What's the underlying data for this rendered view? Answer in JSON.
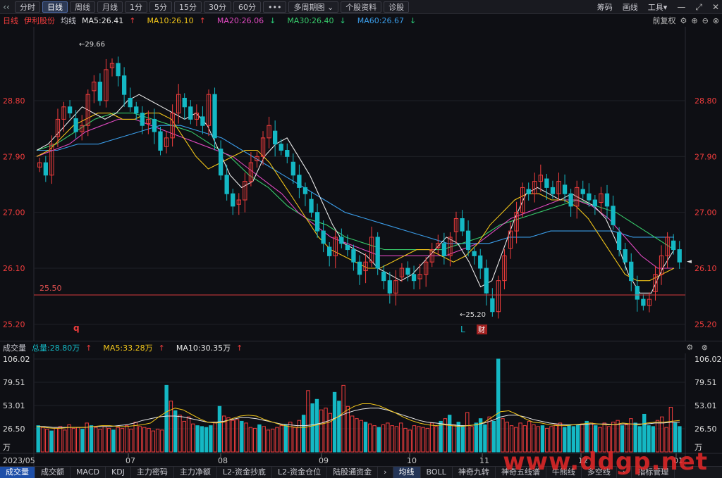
{
  "toolbar": {
    "back_icon": "‹‹",
    "periods": [
      "分时",
      "日线",
      "周线",
      "月线",
      "1分",
      "5分",
      "15分",
      "30分",
      "60分",
      "•••",
      "多周期图 ⌄",
      "个股资料",
      "诊股"
    ],
    "active_period": "日线",
    "right": {
      "chips": "筹码",
      "draw": "画线",
      "tools": "工具▾"
    }
  },
  "info": {
    "period": "日线",
    "stock": "伊利股份",
    "avg_label": "均线",
    "ma5": "MA5:26.41",
    "ma10": "MA10:26.10",
    "ma20": "MA20:26.06",
    "ma30": "MA30:26.40",
    "ma60": "MA60:26.67",
    "adjust": "前复权"
  },
  "volume_header": {
    "title": "成交量",
    "total": "总量:28.80万",
    "ma5": "MA5:33.28万",
    "ma10": "MA10:30.35万"
  },
  "bottom_tabs": [
    "成交量",
    "成交额",
    "MACD",
    "KDJ",
    "主力密码",
    "主力净额",
    "L2-资金抄底",
    "L2-资金仓位",
    "陆股通资金",
    "›",
    "均线",
    "BOLL",
    "神奇九转",
    "神奇五线谱",
    "牛熊线",
    "多空线",
    "›",
    "指标管理"
  ],
  "watermark": "www.ddgp.net",
  "colors": {
    "up": "#f23d3d",
    "down": "#14b8c4",
    "ma5": "#e8e8e8",
    "ma10": "#f0c419",
    "ma20": "#e049c0",
    "ma30": "#37c96a",
    "ma60": "#3a9ce8",
    "ref_line": "#d63b3b"
  },
  "chart_data": [
    {
      "type": "candlestick",
      "price_axis": {
        "ticks": [
          "28.80",
          "27.90",
          "27.00",
          "26.10",
          "25.20"
        ],
        "ylim": [
          25.0,
          29.9
        ]
      },
      "x_ticks": [
        "2023/05",
        "07",
        "08",
        "09",
        "10",
        "11",
        "12",
        "01"
      ],
      "annotations": {
        "high": "29.66",
        "low": "25.20",
        "ref_value": "25.50",
        "marker_q": "q",
        "marker_L": "L",
        "marker_cai": "财",
        "current_price": "26.10"
      },
      "closes": [
        27.8,
        27.6,
        28.1,
        28.5,
        28.7,
        28.6,
        28.3,
        28.4,
        28.9,
        29.1,
        28.8,
        29.3,
        29.4,
        29.2,
        28.9,
        28.7,
        28.6,
        28.4,
        28.5,
        28.3,
        28.0,
        28.2,
        28.6,
        28.9,
        28.7,
        28.5,
        28.6,
        28.4,
        28.9,
        28.2,
        27.6,
        27.3,
        27.1,
        27.2,
        27.5,
        27.8,
        27.9,
        28.2,
        28.4,
        28.1,
        28.0,
        27.9,
        27.6,
        27.4,
        27.3,
        27.0,
        26.7,
        26.5,
        26.3,
        26.6,
        26.5,
        26.4,
        26.2,
        26.0,
        26.2,
        26.6,
        26.1,
        25.9,
        25.7,
        25.9,
        26.1,
        26.0,
        25.9,
        26.0,
        26.2,
        26.4,
        26.5,
        26.3,
        26.6,
        26.9,
        26.7,
        26.4,
        26.3,
        26.1,
        25.7,
        25.4,
        25.9,
        26.3,
        26.7,
        27.0,
        27.4,
        27.3,
        27.5,
        27.6,
        27.4,
        27.3,
        27.5,
        27.3,
        27.1,
        27.4,
        27.3,
        27.2,
        27.1,
        27.3,
        27.1,
        26.8,
        26.4,
        26.2,
        25.9,
        25.6,
        25.5,
        25.6,
        26.0,
        26.3,
        26.6,
        26.4,
        26.2
      ],
      "ma5": [
        28.0,
        28.1,
        28.3,
        28.5,
        28.7,
        28.6,
        28.5,
        28.6,
        28.8,
        28.9,
        28.8,
        28.7,
        28.6,
        28.5,
        28.6,
        28.4,
        28.0,
        27.6,
        27.4,
        27.5,
        27.9,
        28.1,
        28.2,
        27.9,
        27.6,
        27.2,
        26.8,
        26.5,
        26.4,
        26.3,
        26.1,
        26.0,
        25.9,
        26.0,
        26.2,
        26.4,
        26.6,
        26.5,
        26.2,
        25.8,
        25.9,
        26.4,
        26.9,
        27.3,
        27.4,
        27.3,
        27.2,
        27.3,
        27.2,
        27.1,
        26.9,
        26.5,
        26.0,
        25.7,
        25.7,
        26.1,
        26.4
      ],
      "ma10": [
        27.9,
        28.0,
        28.2,
        28.4,
        28.5,
        28.6,
        28.6,
        28.5,
        28.5,
        28.6,
        28.6,
        28.5,
        28.2,
        27.9,
        27.7,
        27.8,
        27.9,
        28.0,
        28.0,
        27.8,
        27.5,
        27.2,
        26.9,
        26.6,
        26.4,
        26.3,
        26.2,
        26.1,
        26.1,
        26.2,
        26.3,
        26.4,
        26.4,
        26.3,
        26.2,
        26.3,
        26.5,
        26.8,
        27.0,
        27.2,
        27.3,
        27.3,
        27.2,
        27.2,
        27.1,
        26.9,
        26.6,
        26.3,
        26.0,
        25.9,
        25.9,
        26.0,
        26.1
      ],
      "ma20": [
        27.9,
        28.0,
        28.1,
        28.3,
        28.4,
        28.5,
        28.5,
        28.4,
        28.3,
        28.2,
        28.1,
        28.0,
        27.9,
        27.7,
        27.5,
        27.3,
        27.0,
        26.8,
        26.6,
        26.5,
        26.4,
        26.3,
        26.3,
        26.3,
        26.3,
        26.3,
        26.4,
        26.5,
        26.7,
        26.9,
        27.0,
        27.1,
        27.2,
        27.2,
        27.1,
        26.9,
        26.6,
        26.3,
        26.1,
        26.1
      ],
      "ma30": [
        28.0,
        28.1,
        28.3,
        28.5,
        28.6,
        28.6,
        28.5,
        28.4,
        28.3,
        28.1,
        27.9,
        27.6,
        27.4,
        27.1,
        26.9,
        26.8,
        26.6,
        26.5,
        26.4,
        26.4,
        26.4,
        26.4,
        26.5,
        26.6,
        26.8,
        26.9,
        27.0,
        27.1,
        27.2,
        27.1,
        27.0,
        26.8,
        26.6,
        26.4
      ],
      "ma60": [
        28.0,
        28.0,
        28.1,
        28.1,
        28.2,
        28.3,
        28.4,
        28.4,
        28.3,
        28.2,
        28.0,
        27.8,
        27.6,
        27.4,
        27.2,
        27.0,
        26.9,
        26.8,
        26.7,
        26.6,
        26.5,
        26.5,
        26.5,
        26.6,
        26.6,
        26.7,
        26.7,
        26.7,
        26.7,
        26.6,
        26.6,
        26.6
      ]
    },
    {
      "type": "bar",
      "volume_axis": {
        "ticks": [
          "106.02",
          "79.51",
          "53.01",
          "26.50",
          "万"
        ],
        "ylim": [
          0,
          106.02
        ]
      },
      "volumes": [
        30,
        28,
        26,
        24,
        27,
        29,
        25,
        31,
        27,
        28,
        26,
        33,
        30,
        28,
        26,
        29,
        27,
        25,
        28,
        27,
        30,
        26,
        34,
        29,
        28,
        27,
        24,
        26,
        25,
        76,
        58,
        47,
        42,
        35,
        40,
        32,
        30,
        29,
        28,
        30,
        34,
        52,
        41,
        39,
        36,
        37,
        35,
        33,
        28,
        27,
        31,
        29,
        25,
        26,
        28,
        30,
        31,
        34,
        28,
        36,
        42,
        70,
        55,
        60,
        48,
        50,
        44,
        68,
        58,
        76,
        52,
        41,
        38,
        36,
        34,
        32,
        30,
        28,
        31,
        33,
        30,
        29,
        33,
        27,
        25,
        30,
        29,
        28,
        27,
        33,
        29,
        35,
        38,
        42,
        31,
        34,
        30,
        45,
        29,
        33,
        38,
        31,
        40,
        35,
        106,
        38,
        34,
        30,
        28,
        33,
        30,
        35,
        31,
        29,
        30,
        27,
        29,
        31,
        33,
        28,
        30,
        29,
        31,
        32,
        35,
        33,
        30,
        28,
        33,
        29,
        34,
        36,
        30,
        31,
        38,
        33,
        29,
        43,
        30,
        29,
        36,
        40,
        28,
        51,
        33,
        29
      ],
      "ma5_vol": [
        29,
        28,
        27,
        27,
        28,
        28,
        28,
        29,
        30,
        30,
        29,
        29,
        30,
        31,
        33,
        40,
        46,
        50,
        48,
        43,
        38,
        34,
        33,
        34,
        38,
        41,
        42,
        41,
        37,
        34,
        31,
        29,
        28,
        28,
        30,
        32,
        34,
        40,
        47,
        52,
        55,
        55,
        53,
        49,
        45,
        40,
        36,
        33,
        31,
        30,
        31,
        30,
        29,
        30,
        31,
        34,
        40,
        46,
        47,
        43,
        38,
        34,
        33,
        31,
        30,
        30,
        31,
        32,
        33,
        32,
        31,
        31,
        33,
        32,
        31,
        33,
        34,
        34,
        35,
        36
      ],
      "ma10_vol": [
        29,
        29,
        28,
        28,
        28,
        28,
        28,
        29,
        29,
        29,
        30,
        31,
        33,
        36,
        38,
        40,
        41,
        41,
        40,
        38,
        36,
        34,
        34,
        35,
        37,
        39,
        39,
        38,
        36,
        34,
        32,
        31,
        30,
        30,
        31,
        33,
        36,
        40,
        44,
        47,
        49,
        50,
        50,
        48,
        45,
        42,
        39,
        36,
        34,
        33,
        32,
        31,
        30,
        30,
        31,
        33,
        36,
        40,
        42,
        42,
        40,
        37,
        35,
        33,
        32,
        31,
        31,
        31,
        32,
        32,
        32,
        31,
        32,
        32,
        32,
        32,
        33,
        33,
        34,
        34
      ]
    }
  ]
}
